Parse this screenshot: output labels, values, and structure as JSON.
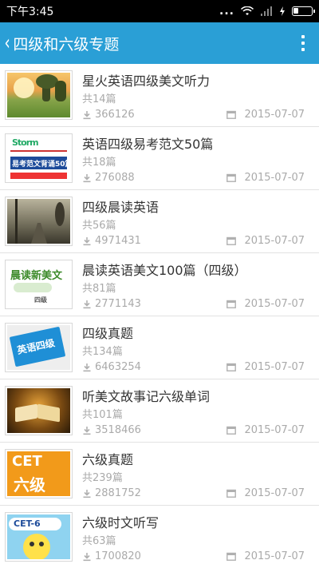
{
  "status_bar": {
    "time": "下午3:45",
    "dots": "...",
    "battery_level": 0.3
  },
  "app_bar": {
    "back_glyph": "‹",
    "title": "四级和六级专题"
  },
  "items": [
    {
      "title": "星火英语四级美文听力",
      "count": "共14篇",
      "downloads": "366126",
      "date": "2015-07-07",
      "thumb_icon": "sunset-landscape-thumbnail"
    },
    {
      "title": "英语四级易考范文50篇",
      "count": "共18篇",
      "downloads": "276088",
      "date": "2015-07-07",
      "thumb_icon": "book-cover-thumbnail",
      "thumb_text": "易考范文背诵50篇"
    },
    {
      "title": "四级晨读英语",
      "count": "共56篇",
      "downloads": "4971431",
      "date": "2015-07-07",
      "thumb_icon": "misty-road-thumbnail"
    },
    {
      "title": "晨读英语美文100篇（四级）",
      "count": "共81篇",
      "downloads": "2771143",
      "date": "2015-07-07",
      "thumb_icon": "book-cover-thumbnail",
      "thumb_text": "晨读新美文",
      "thumb_sub": "四级"
    },
    {
      "title": "四级真题",
      "count": "共134篇",
      "downloads": "6463254",
      "date": "2015-07-07",
      "thumb_icon": "book-cover-thumbnail",
      "thumb_text": "英语四级"
    },
    {
      "title": "听美文故事记六级单词",
      "count": "共101篇",
      "downloads": "3518466",
      "date": "2015-07-07",
      "thumb_icon": "open-book-thumbnail"
    },
    {
      "title": "六级真题",
      "count": "共239篇",
      "downloads": "2881752",
      "date": "2015-07-07",
      "thumb_icon": "cet-thumbnail",
      "thumb_text": "CET",
      "thumb_sub": "六级"
    },
    {
      "title": "六级时文听写",
      "count": "共63篇",
      "downloads": "1700820",
      "date": "2015-07-07",
      "thumb_icon": "cet6-cartoon-thumbnail",
      "thumb_text": "CET-6"
    }
  ]
}
